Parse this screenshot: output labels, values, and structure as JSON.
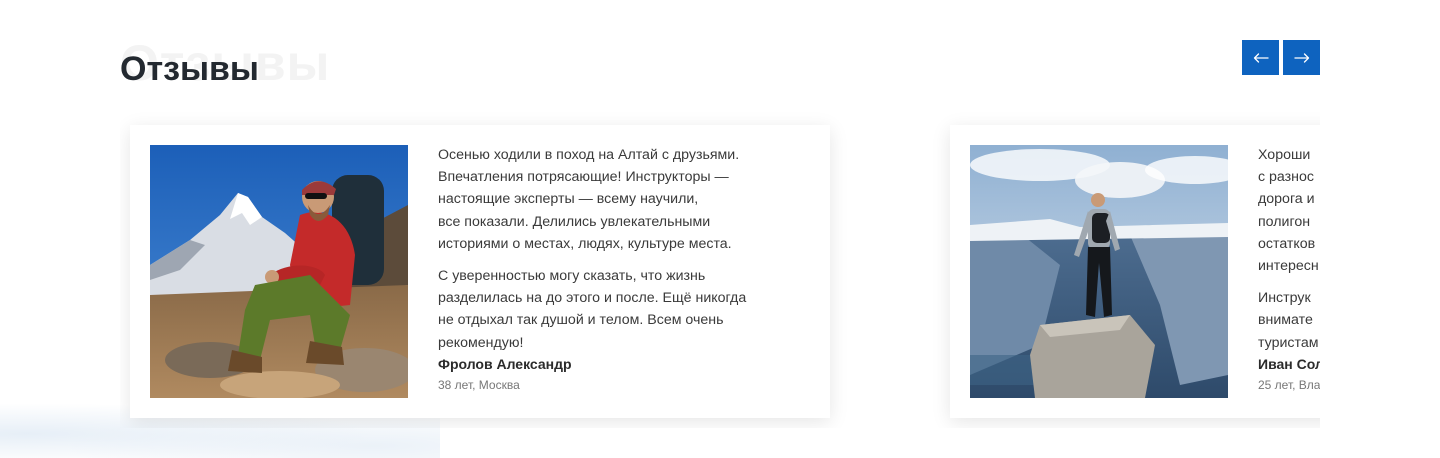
{
  "section": {
    "title": "Отзывы",
    "ghost_title": "Отзывы",
    "prev_icon": "arrow-left-icon",
    "next_icon": "arrow-right-icon",
    "accent_color": "#0e63bf"
  },
  "reviews": [
    {
      "photo": "hiker-sitting-mountains-photo",
      "paragraph1": "Осенью ходили в поход на Алтай с друзьями.\nВпечатления потрясающие! Инструкторы —\nнастоящие эксперты — всему научили,\nвсе показали. Делились увлекательными\nисториями о местах, людях, культуре места.",
      "paragraph2": "С уверенностью могу сказать, что жизнь\nразделилась на до этого и после. Ещё никогда\nне отдыхал так душой и телом. Всем очень\nрекомендую!",
      "author": "Фролов Александр",
      "meta": "38 лет, Москва"
    },
    {
      "photo": "hiker-standing-on-cliff-photo",
      "paragraph1": "Хороши\nс разнос\nдорога и\nполигон\nостатков\nинтересн",
      "paragraph2": "Инструк\nвнимате\nтуристам",
      "author": "Иван Сол",
      "meta": "25 лет, Вла"
    }
  ]
}
